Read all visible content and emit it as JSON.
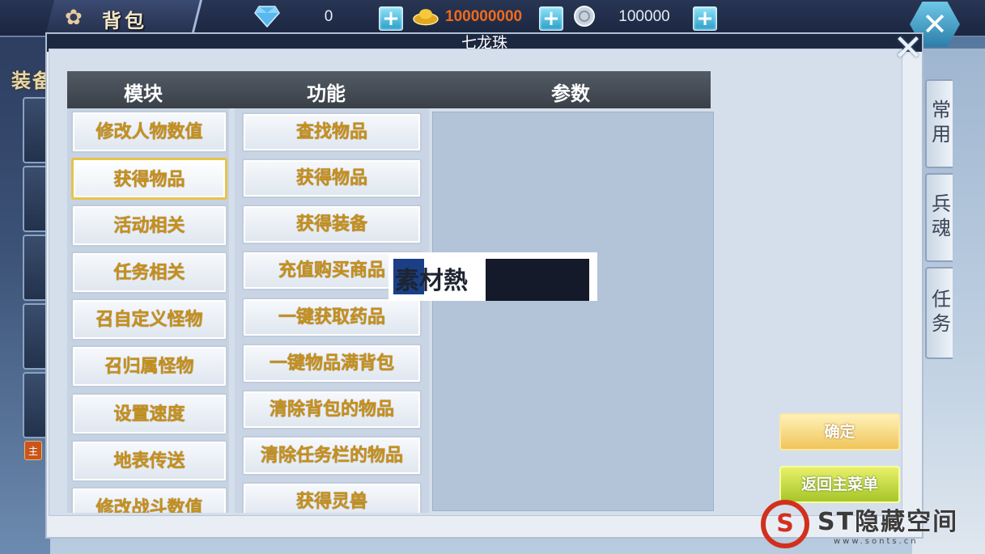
{
  "topbar": {
    "title": "背包",
    "currencies": [
      {
        "name": "diamond",
        "icon": "diamond-icon",
        "value": "0"
      },
      {
        "name": "gold",
        "icon": "gold-ingot-icon",
        "value": "100000000"
      },
      {
        "name": "silver",
        "icon": "silver-coin-icon",
        "value": "100000"
      }
    ]
  },
  "background": {
    "equip_label": "装备",
    "lord_badge": "主",
    "side_tabs": [
      "常用",
      "兵魂",
      "任务"
    ]
  },
  "dialog": {
    "title": "七龙珠",
    "headers": {
      "module": "模块",
      "function": "功能",
      "params": "参数"
    },
    "modules": [
      {
        "label": "修改人物数值",
        "selected": false
      },
      {
        "label": "获得物品",
        "selected": true
      },
      {
        "label": "活动相关",
        "selected": false
      },
      {
        "label": "任务相关",
        "selected": false
      },
      {
        "label": "召自定义怪物",
        "selected": false
      },
      {
        "label": "召归属怪物",
        "selected": false
      },
      {
        "label": "设置速度",
        "selected": false
      },
      {
        "label": "地表传送",
        "selected": false
      },
      {
        "label": "修改战斗数值",
        "selected": false
      }
    ],
    "functions": [
      "查找物品",
      "获得物品",
      "获得装备",
      "充值购买商品",
      "一键获取药品",
      "一键物品满背包",
      "清除背包的物品",
      "清除任务栏的物品",
      "获得灵兽"
    ],
    "confirm_label": "确定",
    "back_label": "返回主菜单"
  },
  "watermarks": {
    "sucai": "素材熱",
    "st_logo": "S",
    "st_text": "ST隐藏空间",
    "st_url": "www.sonts.cn"
  },
  "colors": {
    "button_text": "#c6901b",
    "selected_border": "#e7c34b",
    "gold_value": "#f06a1c"
  }
}
